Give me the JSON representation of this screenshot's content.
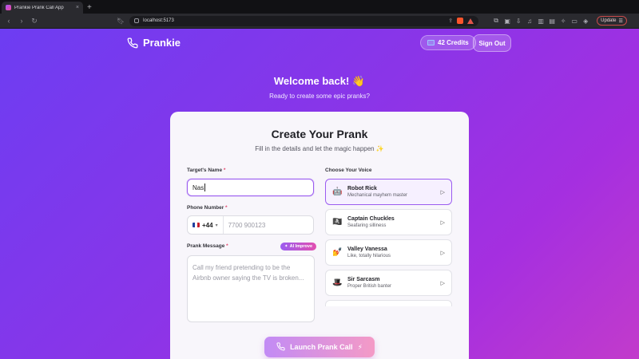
{
  "browser": {
    "tab_title": "Prankie Prank Call App",
    "tab_close": "×",
    "new_tab": "+",
    "url": "localhost:5173",
    "update_label": "Update"
  },
  "header": {
    "brand": "Prankie",
    "credits": "42 Credits",
    "sign_out": "Sign Out"
  },
  "hero": {
    "title": "Welcome back! 👋",
    "subtitle": "Ready to create some epic pranks?"
  },
  "form": {
    "title": "Create Your Prank",
    "subtitle": "Fill in the details and let the magic happen ✨",
    "target_label": "Target's Name",
    "target_value": "Nas",
    "phone_label": "Phone Number",
    "phone_code": "+44",
    "phone_placeholder": "7700 900123",
    "message_label": "Prank Message",
    "ai_improve": "AI Improve",
    "message_placeholder": "Call my friend pretending to be the Airbnb owner saying the TV is broken...",
    "voice_label": "Choose Your Voice",
    "required_mark": "*",
    "launch": "Launch Prank Call"
  },
  "voices": [
    {
      "name": "Robot Rick",
      "desc": "Mechanical mayhem master",
      "icon": "🤖",
      "selected": true
    },
    {
      "name": "Captain Chuckles",
      "desc": "Seafaring silliness",
      "icon": "🏴‍☠️",
      "selected": false
    },
    {
      "name": "Valley Vanessa",
      "desc": "Like, totally hilarious",
      "icon": "💅",
      "selected": false
    },
    {
      "name": "Sir Sarcasm",
      "desc": "Proper British banter",
      "icon": "🎩",
      "selected": false
    }
  ],
  "colors": {
    "accent": "#9b5cf0",
    "required": "#e2456b",
    "gradient_start": "#6d3df2",
    "gradient_end": "#c23bcb"
  }
}
